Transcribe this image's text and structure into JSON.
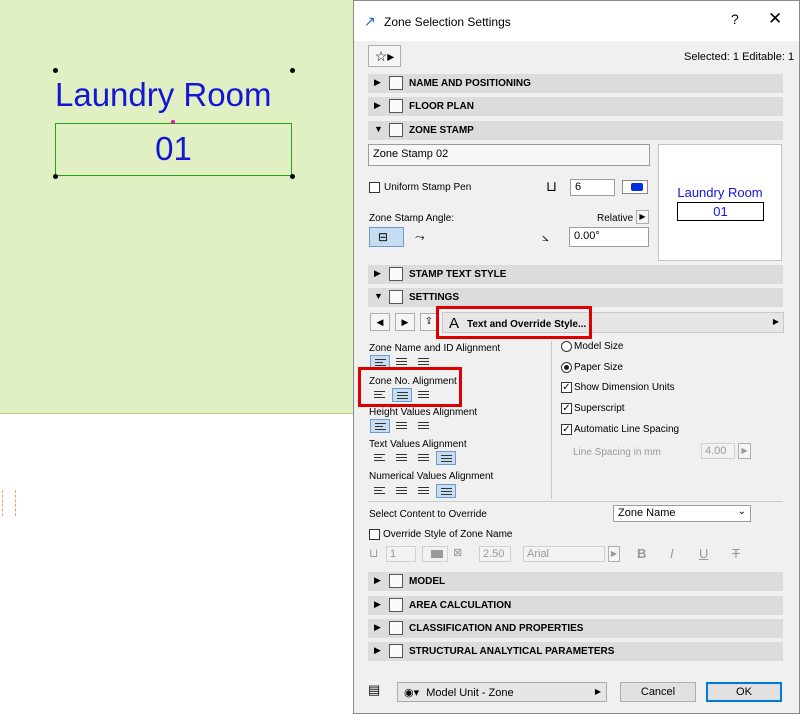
{
  "canvas": {
    "zone_name": "Laundry Room",
    "zone_number": "01"
  },
  "dialog": {
    "title": "Zone Selection Settings",
    "help_label": "?",
    "close_label": "✕",
    "selected_text": "Selected: 1 Editable: 1",
    "favorites_icon": "star-icon",
    "panels": {
      "name_positioning": "NAME AND POSITIONING",
      "floor_plan": "FLOOR PLAN",
      "zone_stamp": "ZONE STAMP",
      "stamp_text_style": "STAMP TEXT STYLE",
      "settings": "SETTINGS",
      "model": "MODEL",
      "area_calculation": "AREA CALCULATION",
      "classification": "CLASSIFICATION AND PROPERTIES",
      "structural": "STRUCTURAL ANALYTICAL PARAMETERS"
    },
    "zone_stamp": {
      "stamp_name": "Zone Stamp 02",
      "uniform_pen_label": "Uniform Stamp Pen",
      "pen_value": "6",
      "angle_label": "Zone Stamp Angle:",
      "relative_label": "Relative",
      "angle_value": "0.00°",
      "preview_name": "Laundry Room",
      "preview_number": "01"
    },
    "settings": {
      "text_override_button": "Text and Override Style...",
      "zone_name_id_alignment": "Zone Name and ID Alignment",
      "zone_no_alignment": "Zone No. Alignment",
      "height_values_alignment": "Height Values Alignment",
      "text_values_alignment": "Text Values Alignment",
      "numerical_values_alignment": "Numerical Values Alignment",
      "model_size": "Model Size",
      "paper_size": "Paper Size",
      "show_dimension_units": "Show Dimension Units",
      "superscript": "Superscript",
      "automatic_line_spacing": "Automatic Line Spacing",
      "line_spacing_label": "Line Spacing in mm",
      "line_spacing_value": "4.00",
      "select_content_label": "Select Content to Override",
      "select_content_value": "Zone Name",
      "override_style_label": "Override Style of Zone Name",
      "override_pen": "1",
      "override_size": "2.50",
      "override_font": "Arial",
      "bold": "B",
      "italic": "I",
      "underline": "U",
      "strike": "T"
    },
    "footer": {
      "model_unit": "Model Unit - Zone",
      "cancel": "Cancel",
      "ok": "OK"
    }
  },
  "colors": {
    "zone_fill": "#e1f0c3",
    "stamp_text": "#1515d6",
    "highlight": "#dd0000",
    "selected_toggle": "#c6dcf0"
  }
}
